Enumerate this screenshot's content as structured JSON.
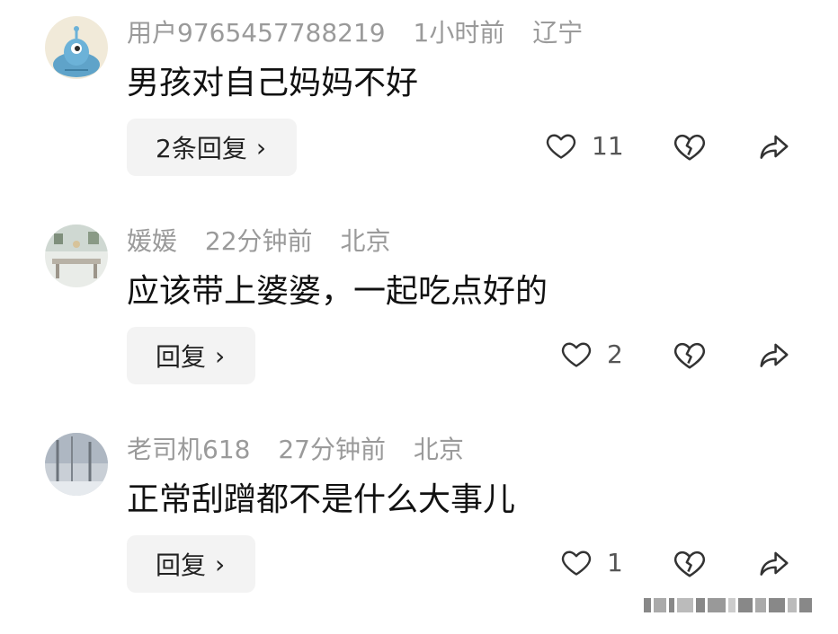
{
  "comments": [
    {
      "username": "用户9765457788219",
      "time": "1小时前",
      "location": "辽宁",
      "text": "男孩对自己妈妈不好",
      "reply_label": "2条回复",
      "likes": "11"
    },
    {
      "username": "媛媛",
      "time": "22分钟前",
      "location": "北京",
      "text": "应该带上婆婆，一起吃点好的",
      "reply_label": "回复",
      "likes": "2"
    },
    {
      "username": "老司机618",
      "time": "27分钟前",
      "location": "北京",
      "text": "正常刮蹭都不是什么大事儿",
      "reply_label": "回复",
      "likes": "1"
    }
  ],
  "icons": {
    "like": "heart-outline-icon",
    "dislike": "broken-heart-icon",
    "share": "share-arrow-icon",
    "reply_chevron": "chevron-right-icon"
  },
  "colors": {
    "meta_text": "#9a9a9a",
    "body_text": "#111111",
    "button_bg": "#f3f3f3"
  }
}
